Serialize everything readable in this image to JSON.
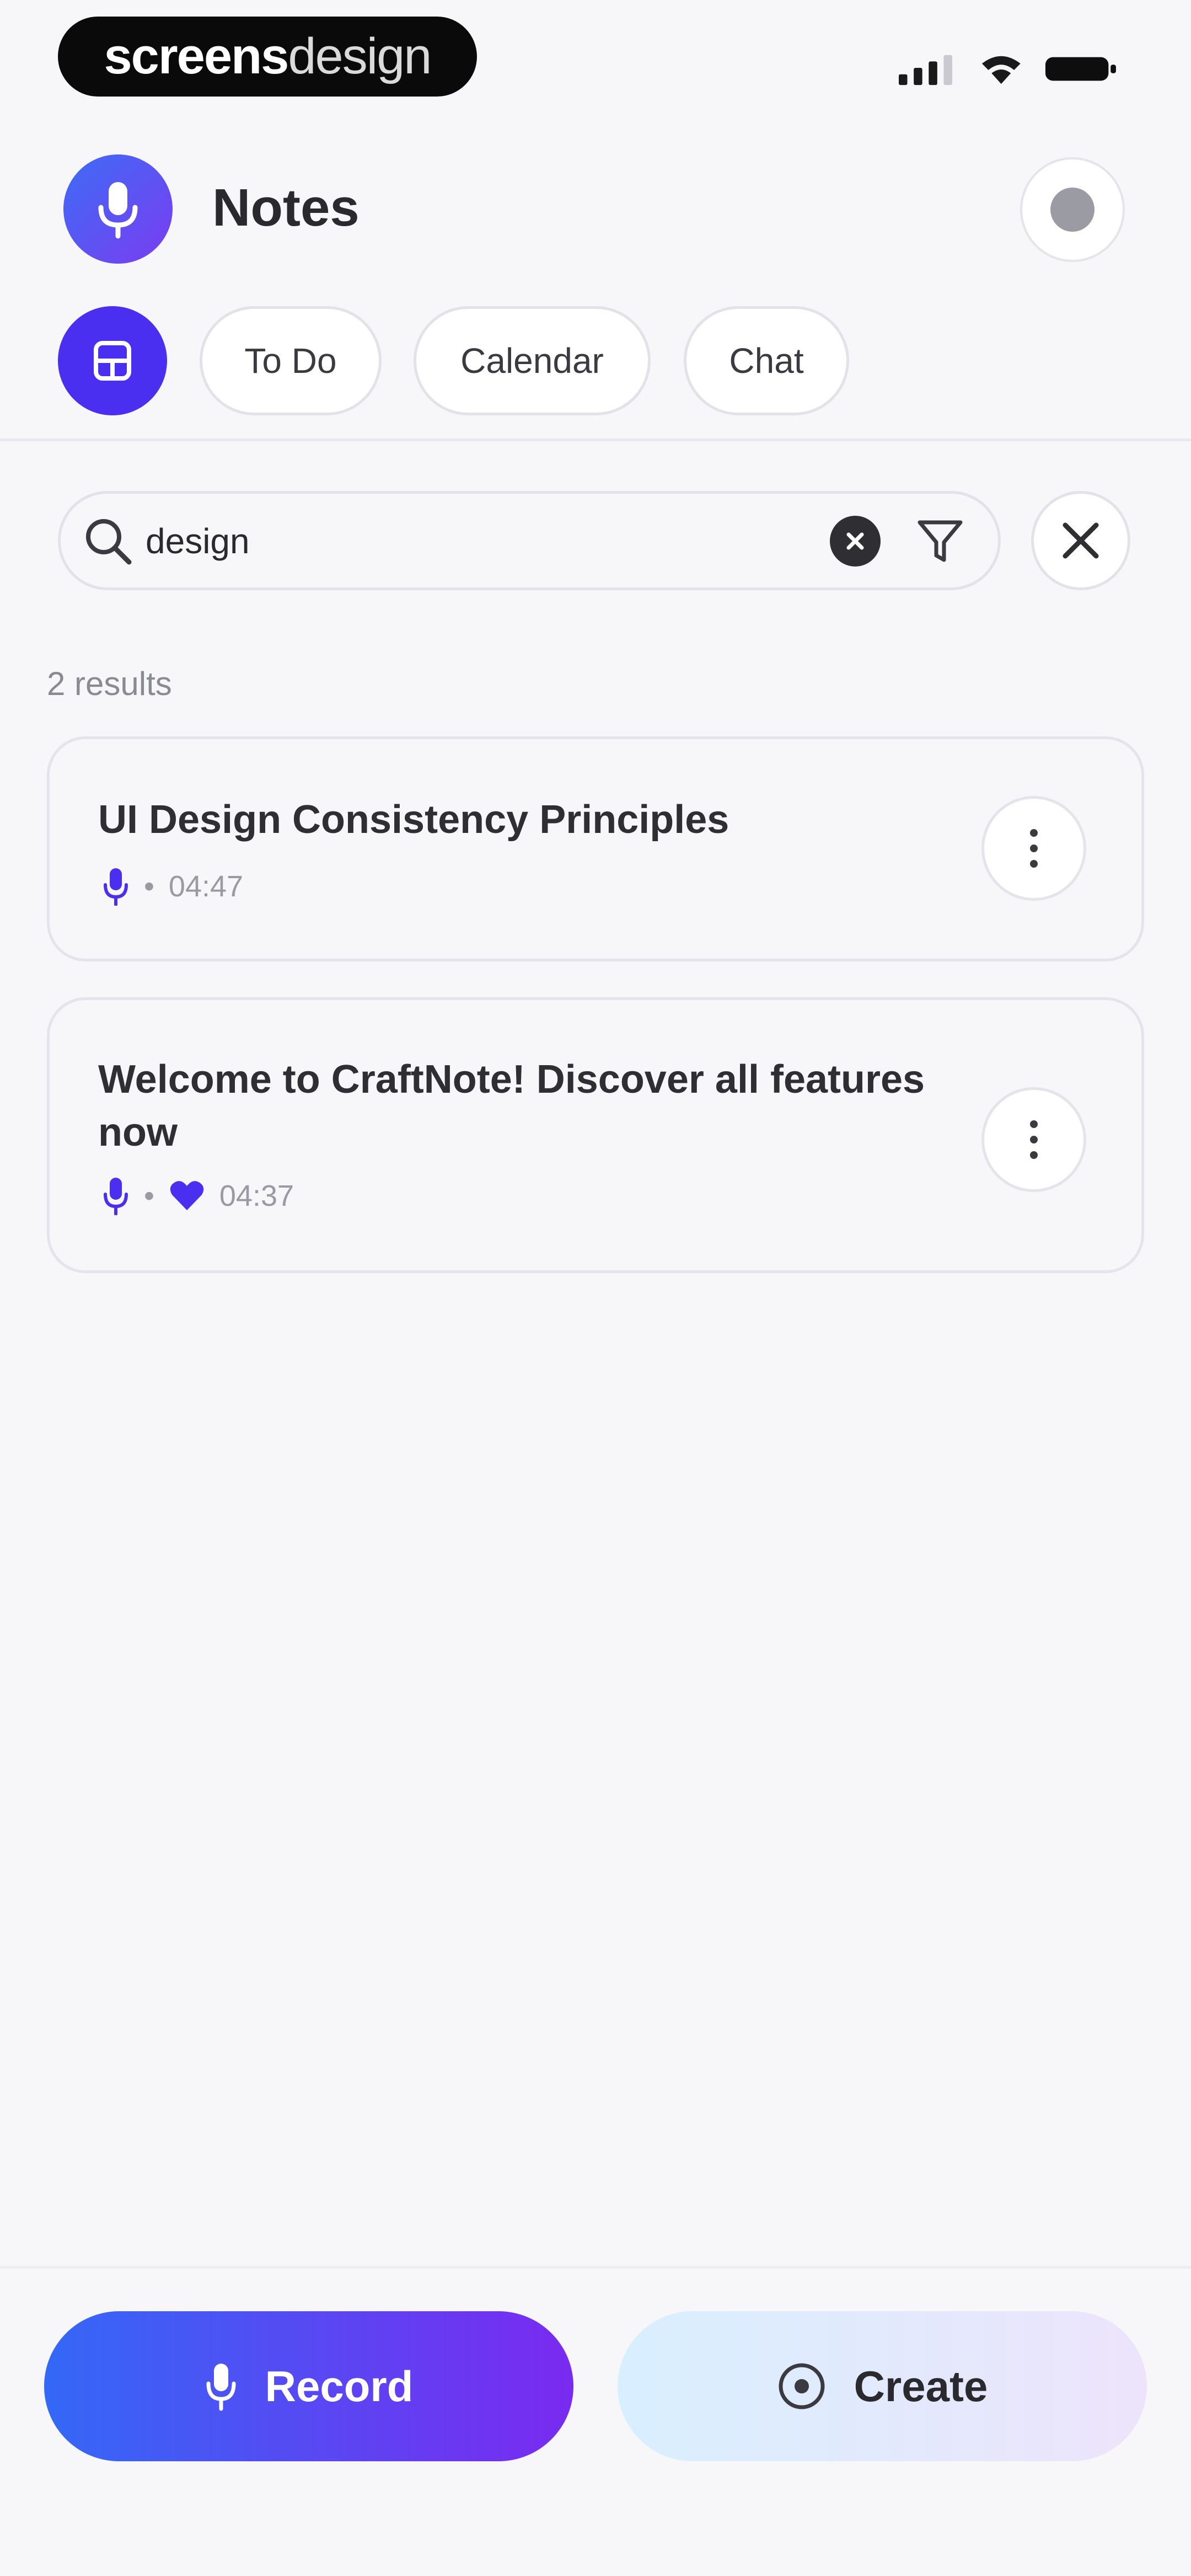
{
  "watermark": {
    "text_bold": "screens",
    "text_light": "design"
  },
  "header": {
    "title": "Notes"
  },
  "tabs": [
    {
      "label": "To Do"
    },
    {
      "label": "Calendar"
    },
    {
      "label": "Chat"
    }
  ],
  "search": {
    "value": "design",
    "placeholder": ""
  },
  "results": {
    "count_label": "2 results",
    "items": [
      {
        "title": "UI Design Consistency Principles",
        "duration": "04:47"
      },
      {
        "title": "Welcome to CraftNote! Discover all features now",
        "duration": "04:37"
      }
    ]
  },
  "actions": {
    "record_label": "Record",
    "create_label": "Create"
  },
  "colors": {
    "accent": "#4a2ff0",
    "gradient_start": "#3468f6",
    "gradient_end": "#7a2af0",
    "background": "#f7f7f9"
  },
  "icons": {
    "app": "microphone-icon",
    "notes_tab": "notes-icon",
    "search": "search-icon",
    "clear": "clear-icon",
    "filter": "filter-icon",
    "close": "close-icon",
    "more": "more-vertical-icon",
    "recording": "microphone-icon",
    "favorite": "heart-icon",
    "create": "plus-circle-icon"
  }
}
